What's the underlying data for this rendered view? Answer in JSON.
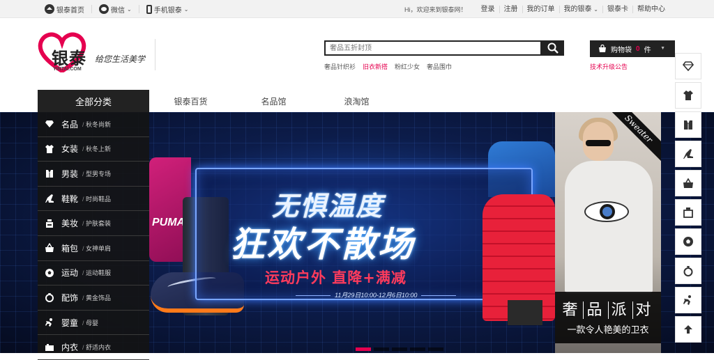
{
  "topbar": {
    "home": "银泰首页",
    "wechat": "微信",
    "mobile": "手机银泰",
    "welcome": "Hi，欢迎来到银泰网！",
    "links": [
      "登录",
      "注册",
      "我的订单",
      "我的银泰",
      "银泰卡",
      "帮助中心"
    ]
  },
  "logo": {
    "brand": "银泰",
    "sub": "YINTAI.COM",
    "slogan": "给您生活美学"
  },
  "search": {
    "placeholder": "奢品五折封顶",
    "hotwords": [
      {
        "text": "奢品针织衫",
        "color": "#555555"
      },
      {
        "text": "旧衣新搭",
        "color": "#e5004f"
      },
      {
        "text": "粉红少女",
        "color": "#555555"
      },
      {
        "text": "奢品围巾",
        "color": "#555555"
      }
    ]
  },
  "cart": {
    "label": "购物袋",
    "count": "0",
    "unit": "件"
  },
  "upgrade_notice": "技术升级公告",
  "nav": {
    "category_title": "全部分类",
    "items": [
      "银泰百货",
      "名品馆",
      "浪淘馆"
    ]
  },
  "categories": [
    {
      "name": "名品",
      "sub": "秋冬尚新",
      "icon": "diamond-icon"
    },
    {
      "name": "女装",
      "sub": "秋冬上新",
      "icon": "dress-icon"
    },
    {
      "name": "男装",
      "sub": "型男专场",
      "icon": "shirt-icon"
    },
    {
      "name": "鞋靴",
      "sub": "时尚鞋品",
      "icon": "heel-icon"
    },
    {
      "name": "美妆",
      "sub": "护肤套装",
      "icon": "cosmetic-icon"
    },
    {
      "name": "箱包",
      "sub": "女神单肩",
      "icon": "bag-icon"
    },
    {
      "name": "运动",
      "sub": "运动鞋服",
      "icon": "ball-icon"
    },
    {
      "name": "配饰",
      "sub": "黄金饰品",
      "icon": "ring-icon"
    },
    {
      "name": "婴童",
      "sub": "母婴",
      "icon": "baby-icon"
    },
    {
      "name": "内衣",
      "sub": "舒适内衣",
      "icon": "underwear-icon"
    }
  ],
  "banner": {
    "headline1": "无惧温度",
    "headline2": "狂欢不散场",
    "subline": "运动户外 直降+满减",
    "date": "11月29日10:00-12月6日10:00",
    "hoodie_text": "PUMA",
    "slides": 5,
    "active_slide": 1
  },
  "promo": {
    "tag": "Sweater",
    "title": [
      "奢",
      "品",
      "派",
      "对"
    ],
    "subtitle": "一款令人艳美的卫衣"
  },
  "sidebar_tools": [
    "diamond-icon",
    "dress-icon",
    "shirt-icon",
    "heel-icon",
    "bag-icon",
    "cosmetic-icon",
    "ball-icon",
    "ring-icon",
    "baby-icon",
    "top-arrow-icon"
  ],
  "colors": {
    "accent": "#e5004f",
    "dark": "#222222"
  }
}
